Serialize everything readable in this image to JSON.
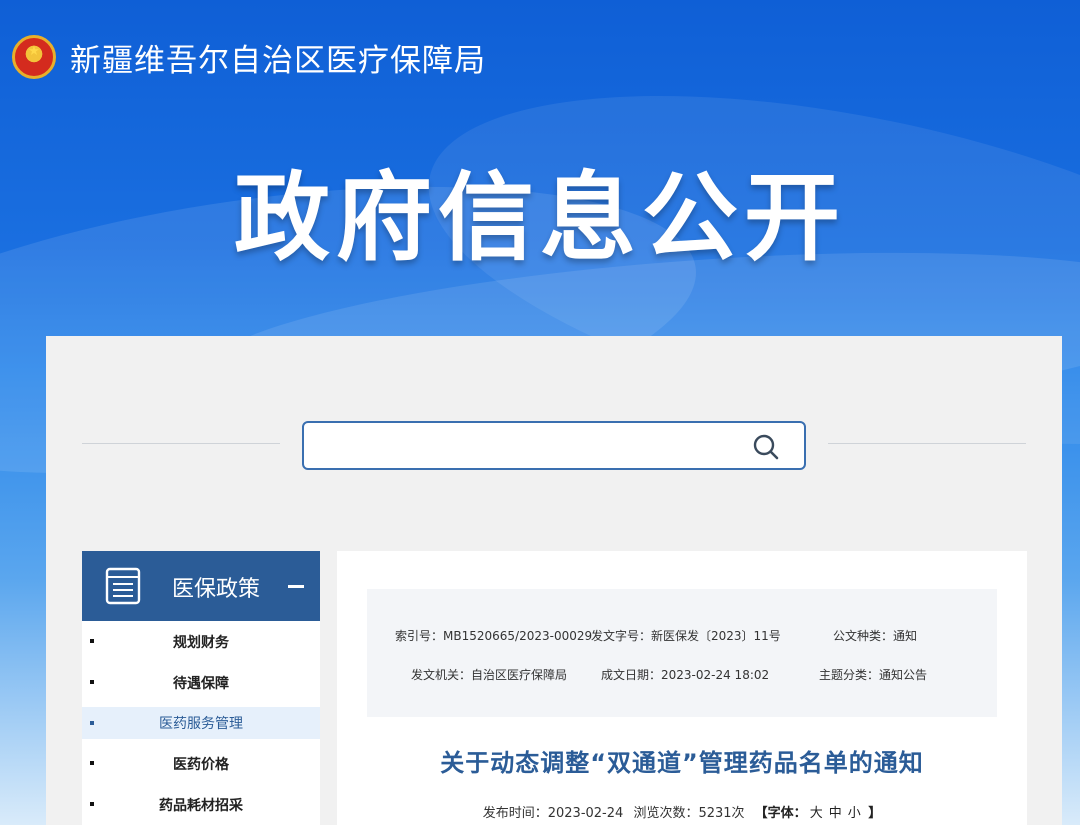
{
  "header": {
    "site_title": "新疆维吾尔自治区医疗保障局",
    "hero_title": "政府信息公开",
    "emblem": "national-emblem"
  },
  "search": {
    "placeholder": "",
    "icon": "search-icon"
  },
  "sidebar": {
    "title": "医保政策",
    "collapse_symbol": "—",
    "items": [
      {
        "label": "规划财务",
        "active": false
      },
      {
        "label": "待遇保障",
        "active": false
      },
      {
        "label": "医药服务管理",
        "active": true
      },
      {
        "label": "医药价格",
        "active": false
      },
      {
        "label": "药品耗材招采",
        "active": false
      }
    ]
  },
  "document": {
    "meta": {
      "index_no": "索引号：MB1520665/2023-00029",
      "doc_no": "发文字号：新医保发〔2023〕11号",
      "doc_type": "公文种类：通知",
      "issuer": "发文机关：自治区医疗保障局",
      "date_created": "成文日期：2023-02-24 18:02",
      "subject": "主题分类：通知公告"
    },
    "title": "关于动态调整“双通道”管理药品名单的通知",
    "publish_time": "发布时间：2023-02-24",
    "views": "浏览次数：5231次",
    "font_ctl": {
      "open": "【字体：",
      "large": "大",
      "medium": "中",
      "small": "小",
      "close": " 】"
    }
  },
  "colors": {
    "brand_blue": "#2b5c97",
    "banner_blue": "#1a6fe0",
    "active_item_bg": "#e6f0fb"
  }
}
